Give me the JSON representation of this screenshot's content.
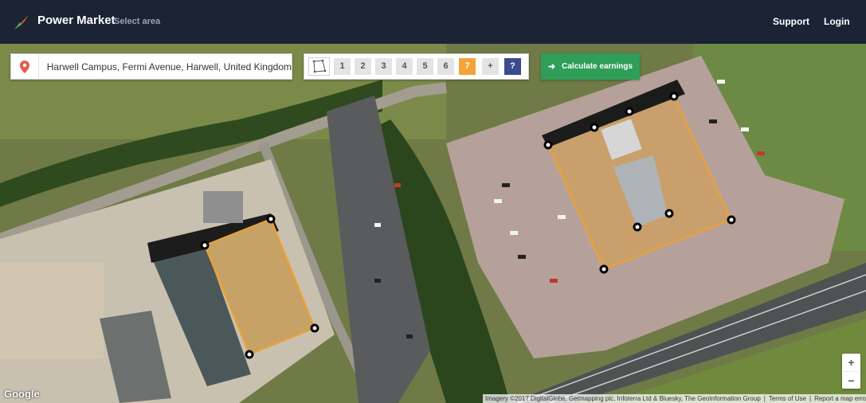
{
  "header": {
    "brand": "Power Market",
    "subtitle": "Select area",
    "nav": {
      "support": "Support",
      "login": "Login"
    }
  },
  "search": {
    "value": "Harwell Campus, Fermi Avenue, Harwell, United Kingdom",
    "icon": "map-pin-icon"
  },
  "area_tools": {
    "polygon_icon": "polygon-draw-icon",
    "areas": [
      "1",
      "2",
      "3",
      "4",
      "5",
      "6",
      "7"
    ],
    "active_area": "7",
    "add": "+",
    "help": "?"
  },
  "calculate": {
    "label": "Calculate earnings",
    "icon": "arrow-right-icon"
  },
  "map": {
    "zoom_in": "+",
    "zoom_out": "−",
    "google": "Google",
    "attribution": "Imagery ©2017 DigitalGlobe, Getmapping plc, Infoterra Ltd & Bluesky, The GeoInformation Group",
    "terms": "Terms of Use",
    "report": "Report a map error"
  },
  "colors": {
    "header_bg": "#1b2334",
    "calc_green": "#2e9e58",
    "active_orange": "#f6a23a",
    "help_blue": "#3a4b8f",
    "selection_orange": "#f0a030"
  }
}
